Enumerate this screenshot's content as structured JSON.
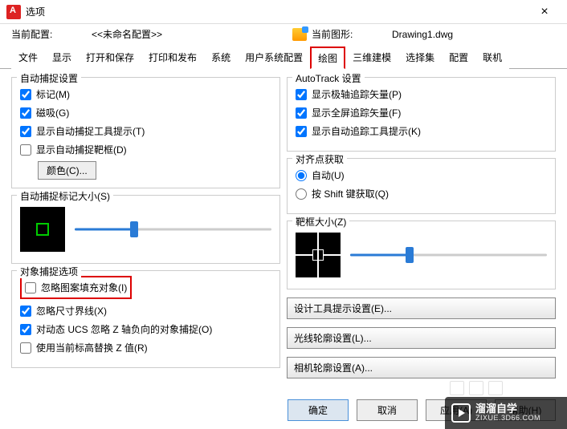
{
  "window": {
    "title": "选项"
  },
  "profile": {
    "current_label": "当前配置:",
    "current_value": "<<未命名配置>>",
    "drawing_label": "当前图形:",
    "drawing_value": "Drawing1.dwg"
  },
  "tabs": {
    "file": "文件",
    "display": "显示",
    "open_save": "打开和保存",
    "print": "打印和发布",
    "system": "系统",
    "user": "用户系统配置",
    "draw": "绘图",
    "three_d": "三维建模",
    "select": "选择集",
    "config": "配置",
    "online": "联机"
  },
  "autosnap_group": {
    "legend": "自动捕捉设置",
    "marker": "标记(M)",
    "magnet": "磁吸(G)",
    "tooltip": "显示自动捕捉工具提示(T)",
    "aperture": "显示自动捕捉靶框(D)",
    "color_btn": "颜色(C)..."
  },
  "marker_size": {
    "legend": "自动捕捉标记大小(S)"
  },
  "object_snap_opts": {
    "legend": "对象捕捉选项",
    "ignore_hatch": "忽略图案填充对象(I)",
    "ignore_dim": "忽略尺寸界线(X)",
    "ucs_negz": "对动态 UCS 忽略 Z 轴负向的对象捕捉(O)",
    "replace_z": "使用当前标高替换 Z 值(R)"
  },
  "autotrack": {
    "legend": "AutoTrack 设置",
    "polar": "显示极轴追踪矢量(P)",
    "full": "显示全屏追踪矢量(F)",
    "tip": "显示自动追踪工具提示(K)"
  },
  "alignment": {
    "legend": "对齐点获取",
    "auto": "自动(U)",
    "shift": "按 Shift 键获取(Q)"
  },
  "aperture_size": {
    "legend": "靶框大小(Z)"
  },
  "design": {
    "tooltip_btn": "设计工具提示设置(E)...",
    "ray_btn": "光线轮廓设置(L)...",
    "camera_btn": "相机轮廓设置(A)..."
  },
  "footer": {
    "ok": "确定",
    "cancel": "取消",
    "apply": "应用(A)",
    "help": "帮助(H)"
  },
  "watermark": {
    "brand": "溜溜自学",
    "url": "ZIXUE.3D66.COM"
  },
  "sliders": {
    "marker_pct": 30,
    "aperture_pct": 30
  }
}
